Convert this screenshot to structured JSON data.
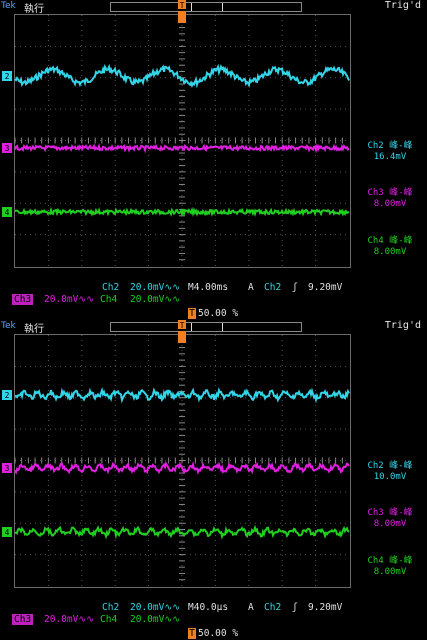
{
  "panels": [
    {
      "id": "top",
      "header": {
        "brand": "Tek",
        "run_state": "執行",
        "trig_state": "Trig'd"
      },
      "measurements": [
        {
          "channel": "Ch2 峰-峰",
          "value": "16.4mV",
          "color": "#33d6e8"
        },
        {
          "channel": "Ch3 峰-峰",
          "value": "8.00mV",
          "color": "#e020e0"
        },
        {
          "channel": "Ch4 峰-峰",
          "value": "8.00mV",
          "color": "#20d020"
        }
      ],
      "status": {
        "ch2_label": "Ch2",
        "ch2_scale": "20.0mV∿∿",
        "timebase": "M4.00ms",
        "trigger_mode": "A",
        "trigger_source": "Ch2",
        "trigger_slope": "ʃ",
        "trigger_level": "9.20mV",
        "ch3_label": "Ch3",
        "ch3_scale": "20.0mV∿∿",
        "ch4_label": "Ch4",
        "ch4_scale": "20.0mV∿∿",
        "trigger_position": "50.00 %"
      }
    },
    {
      "id": "bottom",
      "header": {
        "brand": "Tek",
        "run_state": "執行",
        "trig_state": "Trig'd"
      },
      "measurements": [
        {
          "channel": "Ch2 峰-峰",
          "value": "10.0mV",
          "color": "#33d6e8"
        },
        {
          "channel": "Ch3 峰-峰",
          "value": "8.00mV",
          "color": "#e020e0"
        },
        {
          "channel": "Ch4 峰-峰",
          "value": "8.00mV",
          "color": "#20d020"
        }
      ],
      "status": {
        "ch2_label": "Ch2",
        "ch2_scale": "20.0mV∿∿",
        "timebase": "M40.0μs",
        "trigger_mode": "A",
        "trigger_source": "Ch2",
        "trigger_slope": "ʃ",
        "trigger_level": "9.20mV",
        "ch3_label": "Ch3",
        "ch3_scale": "20.0mV∿∿",
        "ch4_label": "Ch4",
        "ch4_scale": "20.0mV∿∿",
        "trigger_position": "50.00 %"
      }
    }
  ],
  "colors": {
    "ch2": "#33d6e8",
    "ch3": "#e020e0",
    "ch4": "#20d020",
    "trigger": "#f08020"
  }
}
